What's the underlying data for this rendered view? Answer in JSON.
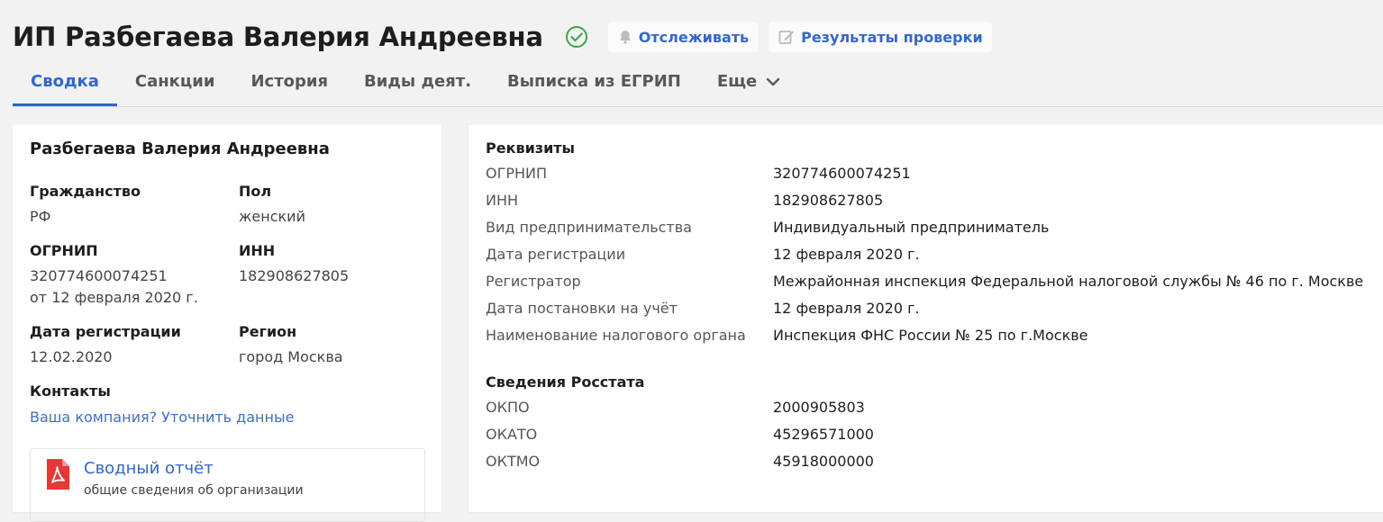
{
  "header": {
    "title": "ИП Разбегаева Валерия Андреевна",
    "verified_icon": "check-circle-icon",
    "track_label": "Отслеживать",
    "track_icon": "bell-icon",
    "results_label": "Результаты проверки",
    "results_icon": "edit-icon"
  },
  "tabs": [
    {
      "label": "Сводка",
      "active": true
    },
    {
      "label": "Санкции",
      "active": false
    },
    {
      "label": "История",
      "active": false
    },
    {
      "label": "Виды деят.",
      "active": false
    },
    {
      "label": "Выписка из ЕГРИП",
      "active": false
    },
    {
      "label": "Еще",
      "active": false,
      "icon": "chevron-down-icon"
    }
  ],
  "summary": {
    "name": "Разбегаева Валерия Андреевна",
    "citizenship_label": "Гражданство",
    "citizenship_value": "РФ",
    "gender_label": "Пол",
    "gender_value": "женский",
    "ogrnip_label": "ОГРНИП",
    "ogrnip_value": "320774600074251",
    "ogrnip_date": "от 12 февраля 2020 г.",
    "inn_label": "ИНН",
    "inn_value": "182908627805",
    "regdate_label": "Дата регистрации",
    "regdate_value": "12.02.2020",
    "region_label": "Регион",
    "region_value": "город Москва",
    "contacts_label": "Контакты",
    "contacts_link": "Ваша компания? Уточнить данные",
    "report_title": "Сводный отчёт",
    "report_subtitle": "общие сведения об организации",
    "report_icon": "pdf-icon"
  },
  "requisites": {
    "title": "Реквизиты",
    "rows": [
      {
        "label": "ОГРНИП",
        "value": "320774600074251"
      },
      {
        "label": "ИНН",
        "value": "182908627805"
      },
      {
        "label": "Вид предпринимательства",
        "value": "Индивидуальный предприниматель"
      },
      {
        "label": "Дата регистрации",
        "value": "12 февраля 2020 г."
      },
      {
        "label": "Регистратор",
        "value": "Межрайонная инспекция Федеральной налоговой службы № 46 по г. Москве"
      },
      {
        "label": "Дата постановки на учёт",
        "value": "12 февраля 2020 г."
      },
      {
        "label": "Наименование налогового органа",
        "value": "Инспекция ФНС России № 25 по г.Москве"
      }
    ]
  },
  "rosstat": {
    "title": "Сведения Росстата",
    "rows": [
      {
        "label": "ОКПО",
        "value": "2000905803"
      },
      {
        "label": "ОКАТО",
        "value": "45296571000"
      },
      {
        "label": "ОКТМО",
        "value": "45918000000"
      }
    ]
  },
  "colors": {
    "accent": "#2d66d8",
    "success": "#3aa84a",
    "pdf": "#e53935"
  }
}
